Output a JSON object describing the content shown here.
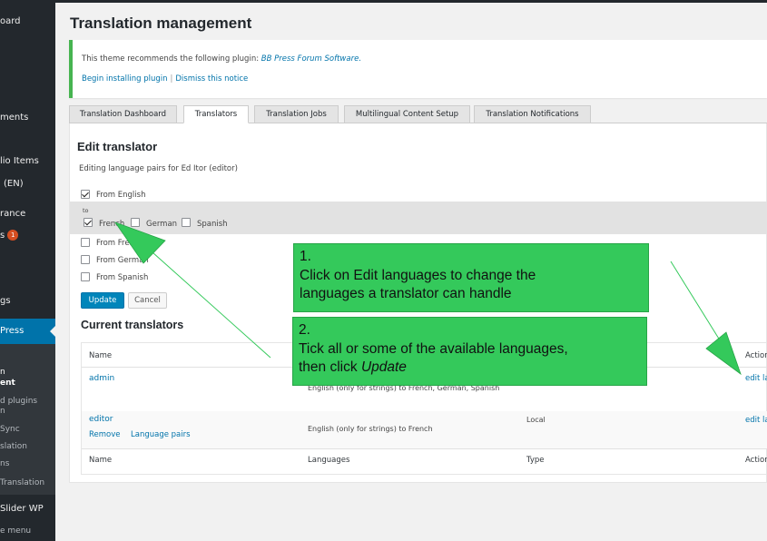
{
  "sidebar": {
    "items": [
      {
        "label": "oard"
      },
      {
        "label": "ments"
      },
      {
        "label": "lio Items"
      },
      {
        "label": "(EN)"
      },
      {
        "label": "rance"
      },
      {
        "label": "s",
        "badge": "1"
      },
      {
        "label": "gs"
      },
      {
        "label": "Press"
      },
      {
        "label": "Slider WP"
      },
      {
        "label": "e menu"
      }
    ],
    "submenu": [
      {
        "label": "n"
      },
      {
        "label": "ent"
      },
      {
        "label": "d plugins"
      },
      {
        "label": "n"
      },
      {
        "label": "Sync"
      },
      {
        "label": "slation"
      },
      {
        "label": "ns"
      },
      {
        "label": "Translation"
      }
    ]
  },
  "page": {
    "title": "Translation management"
  },
  "notice": {
    "message": "This theme recommends the following plugin:",
    "plugin_name": "BB Press Forum Software.",
    "begin_link": "Begin installing plugin",
    "separator": "|",
    "dismiss_link": "Dismiss this notice"
  },
  "tabs": [
    {
      "label": "Translation Dashboard",
      "active": false
    },
    {
      "label": "Translators",
      "active": true
    },
    {
      "label": "Translation Jobs",
      "active": false
    },
    {
      "label": "Multilingual Content Setup",
      "active": false
    },
    {
      "label": "Translation Notifications",
      "active": false
    }
  ],
  "edit_translator": {
    "heading": "Edit translator",
    "description": "Editing language pairs for Ed Itor (editor)",
    "from_english": "From English",
    "to_label": "to",
    "to_languages": [
      {
        "label": "French",
        "checked": true
      },
      {
        "label": "German",
        "checked": false
      },
      {
        "label": "Spanish",
        "checked": false
      }
    ],
    "from_french": "From French",
    "from_german": "From German",
    "from_spanish": "From Spanish",
    "update_button": "Update",
    "cancel_button": "Cancel"
  },
  "current_translators": {
    "heading": "Current translators",
    "columns": {
      "name": "Name",
      "languages": "Languages",
      "type": "Type",
      "actions": "Action"
    },
    "rows": [
      {
        "name": "admin",
        "languages": "English (only for strings) to French, German, Spanish",
        "type": "",
        "action": "edit la",
        "row_actions": []
      },
      {
        "name": "editor",
        "languages": "English (only for strings) to French",
        "type": "Local",
        "action": "edit la",
        "row_actions": [
          "Remove",
          "Language pairs"
        ]
      }
    ]
  },
  "callouts": {
    "step1_number": "1.",
    "step1_line1": "Click on Edit languages to change the",
    "step1_line2": "languages a translator can handle",
    "step2_number": "2.",
    "step2_line1": "Tick all or some of the available languages,",
    "step2_line2_prefix": "then click",
    "step2_line2_emph": "Update"
  },
  "colors": {
    "sidebar_bg": "#23282d",
    "sidebar_active": "#0073aa",
    "link": "#0073aa",
    "notice_border": "#46b450",
    "callout_bg": "#34c95b",
    "primary_button": "#0085ba"
  }
}
